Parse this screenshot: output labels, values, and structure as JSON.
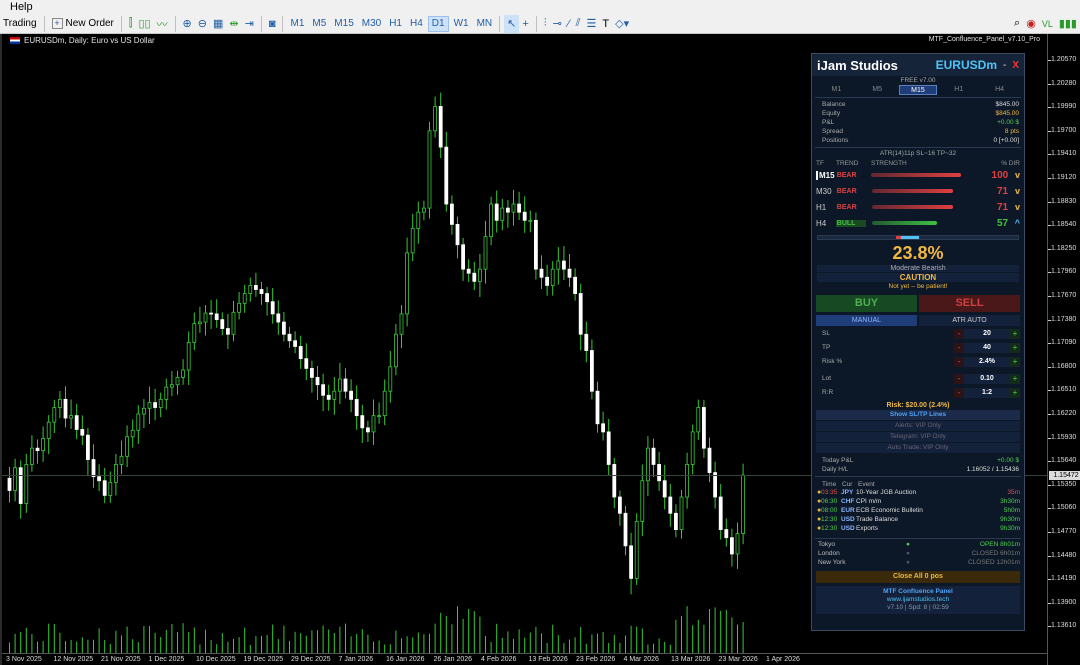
{
  "menu": {
    "help": "Help"
  },
  "toolbar": {
    "trading": "Trading",
    "new_order": "New Order",
    "timeframes": [
      "M1",
      "M5",
      "M15",
      "M30",
      "H1",
      "H4",
      "D1",
      "W1",
      "MN"
    ],
    "active_tf": "D1",
    "badge_vl": "VL"
  },
  "chart": {
    "symbol_title": "EURUSDm, Daily:  Euro vs US Dollar",
    "panel_name": "MTF_Confluence_Panel_v7.10_Pro",
    "current_price": "1.15472",
    "price_labels": [
      "1.20570",
      "1.20280",
      "1.19990",
      "1.19700",
      "1.19410",
      "1.19120",
      "1.18830",
      "1.18540",
      "1.18250",
      "1.17960",
      "1.17670",
      "1.17380",
      "1.17090",
      "1.16800",
      "1.16510",
      "1.16220",
      "1.15930",
      "1.15640",
      "1.15350",
      "1.15060",
      "1.14770",
      "1.14480",
      "1.14190",
      "1.13900",
      "1.13610"
    ],
    "date_labels": [
      "3 Nov 2025",
      "12 Nov 2025",
      "21 Nov 2025",
      "1 Dec 2025",
      "10 Dec 2025",
      "19 Dec 2025",
      "29 Dec 2025",
      "7 Jan 2026",
      "16 Jan 2026",
      "26 Jan 2026",
      "4 Feb 2026",
      "13 Feb 2026",
      "23 Feb 2026",
      "4 Mar 2026",
      "13 Mar 2026",
      "23 Mar 2026",
      "1 Apr 2026"
    ]
  },
  "chart_data": {
    "type": "candlestick",
    "price_range": [
      1.134,
      1.209
    ],
    "closes": [
      1.1528,
      1.1556,
      1.1512,
      1.156,
      1.158,
      1.1577,
      1.1592,
      1.1612,
      1.163,
      1.164,
      1.1617,
      1.162,
      1.1603,
      1.1596,
      1.1566,
      1.1545,
      1.154,
      1.1522,
      1.1538,
      1.156,
      1.157,
      1.1594,
      1.1602,
      1.1622,
      1.1629,
      1.1636,
      1.163,
      1.164,
      1.1655,
      1.1658,
      1.1667,
      1.1676,
      1.171,
      1.1733,
      1.1735,
      1.1746,
      1.1745,
      1.1738,
      1.1727,
      1.172,
      1.1747,
      1.1758,
      1.177,
      1.178,
      1.1775,
      1.177,
      1.176,
      1.1745,
      1.1735,
      1.172,
      1.1712,
      1.1705,
      1.169,
      1.1678,
      1.1667,
      1.1658,
      1.1645,
      1.164,
      1.165,
      1.1665,
      1.165,
      1.164,
      1.162,
      1.1605,
      1.16,
      1.162,
      1.162,
      1.165,
      1.168,
      1.172,
      1.1745,
      1.182,
      1.185,
      1.187,
      1.1875,
      1.197,
      1.2,
      1.195,
      1.188,
      1.1855,
      1.183,
      1.18,
      1.1795,
      1.1785,
      1.18,
      1.184,
      1.188,
      1.186,
      1.1875,
      1.187,
      1.188,
      1.187,
      1.186,
      1.186,
      1.18,
      1.179,
      1.178,
      1.18,
      1.181,
      1.18,
      1.179,
      1.177,
      1.172,
      1.17,
      1.165,
      1.161,
      1.16,
      1.156,
      1.152,
      1.15,
      1.146,
      1.142,
      1.149,
      1.154,
      1.158,
      1.156,
      1.154,
      1.152,
      1.15,
      1.148,
      1.152,
      1.156,
      1.16,
      1.163,
      1.158,
      1.155,
      1.152,
      1.148,
      1.147,
      1.145,
      1.1475,
      1.1547
    ]
  },
  "panel": {
    "brand": "iJam Studios",
    "symbol": "EURUSDm",
    "min": "-",
    "close": "X",
    "edition": "FREE v7.00",
    "tf_tabs": [
      "M1",
      "M5",
      "M15",
      "H1",
      "H4"
    ],
    "tf_active": "M15",
    "account": [
      {
        "k": "Balance",
        "v": "$845.00",
        "c": "#dddddd"
      },
      {
        "k": "Equity",
        "v": "$845.00",
        "c": "#f0b840"
      },
      {
        "k": "P&L",
        "v": "+0.00 $",
        "c": "#50d050"
      },
      {
        "k": "Spread",
        "v": "8 pts",
        "c": "#f0b840"
      },
      {
        "k": "Positions",
        "v": "0 [+0.00]",
        "c": "#dddddd"
      }
    ],
    "atr": "ATR(14)11p  SL~16  TP~32",
    "hdr": {
      "tf": "TF",
      "trend": "TREND",
      "strength": "STRENGTH",
      "dir": "% DIR"
    },
    "rows": [
      {
        "tf": "M15",
        "trend": "BEAR",
        "pct": "100",
        "dir": "v",
        "level": 1.0,
        "color": "#e04040",
        "cur": true
      },
      {
        "tf": "M30",
        "trend": "BEAR",
        "pct": "71",
        "dir": "v",
        "level": 0.9,
        "color": "#e04040",
        "cur": false
      },
      {
        "tf": "H1",
        "trend": "BEAR",
        "pct": "71",
        "dir": "v",
        "level": 0.9,
        "color": "#e04040",
        "cur": false
      },
      {
        "tf": "H4",
        "trend": "BULL",
        "pct": "57",
        "dir": "^",
        "level": 0.72,
        "color": "#40c040",
        "cur": false
      }
    ],
    "confluence": "23.8%",
    "mood": "Moderate Bearish",
    "caution": "CAUTION",
    "patient": "Not yet -- be patient!",
    "buy": "BUY",
    "sell": "SELL",
    "modes": [
      "MANUAL",
      "ATR AUTO"
    ],
    "inputs": [
      {
        "k": "SL",
        "v": "20"
      },
      {
        "k": "TP",
        "v": "40"
      },
      {
        "k": "Risk %",
        "v": "2.4%"
      },
      {
        "k": "Lot",
        "v": "0.10"
      },
      {
        "k": "R:R",
        "v": "1:2"
      }
    ],
    "risk": "Risk: $20.00 (2.4%)",
    "show_sltp": "Show SL/TP Lines",
    "alerts": "Alerts: VIP Only",
    "telegram": "Telegram: VIP Only",
    "auto_trade": "Auto Trade: VIP Only",
    "today_pl_k": "Today P&L",
    "today_pl_v": "+0.00 $",
    "daily_hl_k": "Daily H/L",
    "daily_hl_v": "1.16052 / 1.15436",
    "ev_hdr": {
      "time": "Time",
      "cur": "Cur",
      "event": "Event"
    },
    "events": [
      {
        "t": "03:35",
        "c": "JPY",
        "n": "10-Year JGB Auction",
        "r": "35m",
        "tc": "#e05050",
        "rc": "#e05050"
      },
      {
        "t": "06:30",
        "c": "CHF",
        "n": "CPI m/m",
        "r": "3h30m",
        "tc": "#50d050",
        "rc": "#50d050"
      },
      {
        "t": "08:00",
        "c": "EUR",
        "n": "ECB Economic Bulletin",
        "r": "5h0m",
        "tc": "#50d050",
        "rc": "#50d050"
      },
      {
        "t": "12:30",
        "c": "USD",
        "n": "Trade Balance",
        "r": "9h30m",
        "tc": "#50d050",
        "rc": "#50d050"
      },
      {
        "t": "12:30",
        "c": "USD",
        "n": "Exports",
        "r": "9h30m",
        "tc": "#50d050",
        "rc": "#50d050"
      }
    ],
    "sessions": [
      {
        "n": "Tokyo",
        "s": "OPEN  8h01m",
        "c": "#50d050",
        "dc": "#50d050"
      },
      {
        "n": "London",
        "s": "CLOSED  6h01m",
        "c": "#777777",
        "dc": "#555555"
      },
      {
        "n": "New York",
        "s": "CLOSED  12h01m",
        "c": "#777777",
        "dc": "#555555"
      }
    ],
    "close_all": "Close All 0 pos",
    "footer_title": "MTF Confluence Panel",
    "footer_url": "www.ijamstudios.tech",
    "footer_ver": "v7.10  |  Spd: 8  |  02:59"
  }
}
